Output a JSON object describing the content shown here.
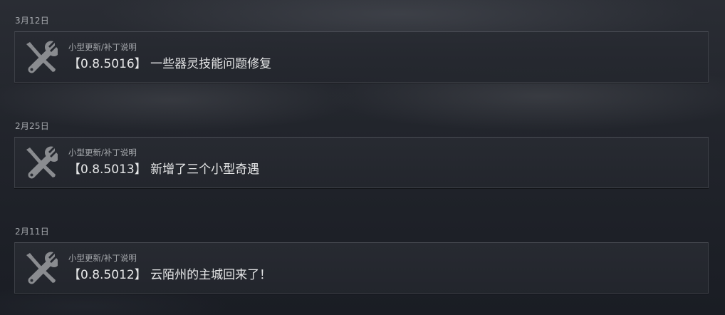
{
  "events": [
    {
      "date": "3月12日",
      "type": "小型更新/补丁说明",
      "title": "【0.8.5016】 一些器灵技能问题修复",
      "icon": "wrench-screwdriver-icon"
    },
    {
      "date": "2月25日",
      "type": "小型更新/补丁说明",
      "title": "【0.8.5013】 新增了三个小型奇遇",
      "icon": "wrench-screwdriver-icon"
    },
    {
      "date": "2月11日",
      "type": "小型更新/补丁说明",
      "title": "【0.8.5012】 云陌州的主城回来了！",
      "icon": "wrench-screwdriver-icon"
    }
  ],
  "colors": {
    "icon": "#8a8c90",
    "date": "#a5a8ad",
    "type": "#a7aaae",
    "title": "#e6e7e8",
    "card_border": "#3c3f46"
  }
}
